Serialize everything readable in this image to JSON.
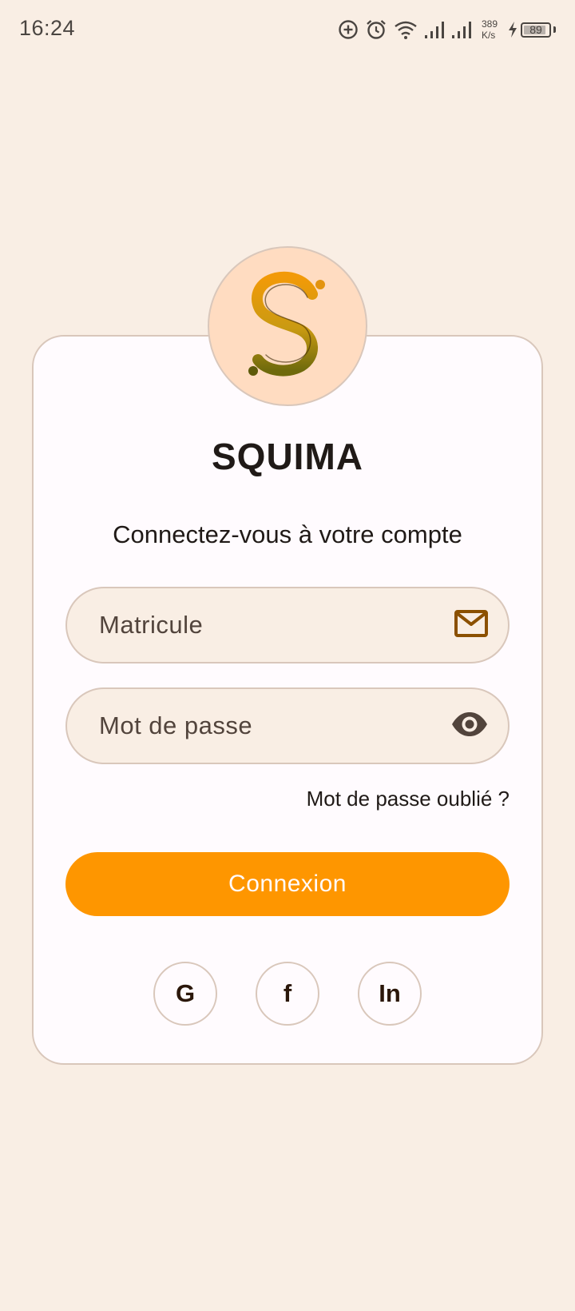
{
  "status_bar": {
    "time": "16:24",
    "net_speed_value": "389",
    "net_speed_unit": "K/s",
    "battery_level": "89",
    "battery_fraction": 0.89
  },
  "app": {
    "title": "SQUIMA",
    "subtitle": "Connectez-vous à votre compte"
  },
  "form": {
    "matricule_placeholder": "Matricule",
    "matricule_icon": "mail-icon",
    "password_placeholder": "Mot de passe",
    "password_icon": "eye-icon",
    "forgot_label": "Mot de passe oublié ?",
    "submit_label": "Connexion"
  },
  "social": [
    {
      "label": "G",
      "provider_icon": "google"
    },
    {
      "label": "f",
      "provider_icon": "facebook"
    },
    {
      "label": "In",
      "provider_icon": "linkedin"
    }
  ],
  "colors": {
    "background": "#f9eee4",
    "card": "#fffbfe",
    "accent": "#fe9600",
    "logo_circle": "#ffdcc1",
    "icon_brown": "#8b5000"
  }
}
